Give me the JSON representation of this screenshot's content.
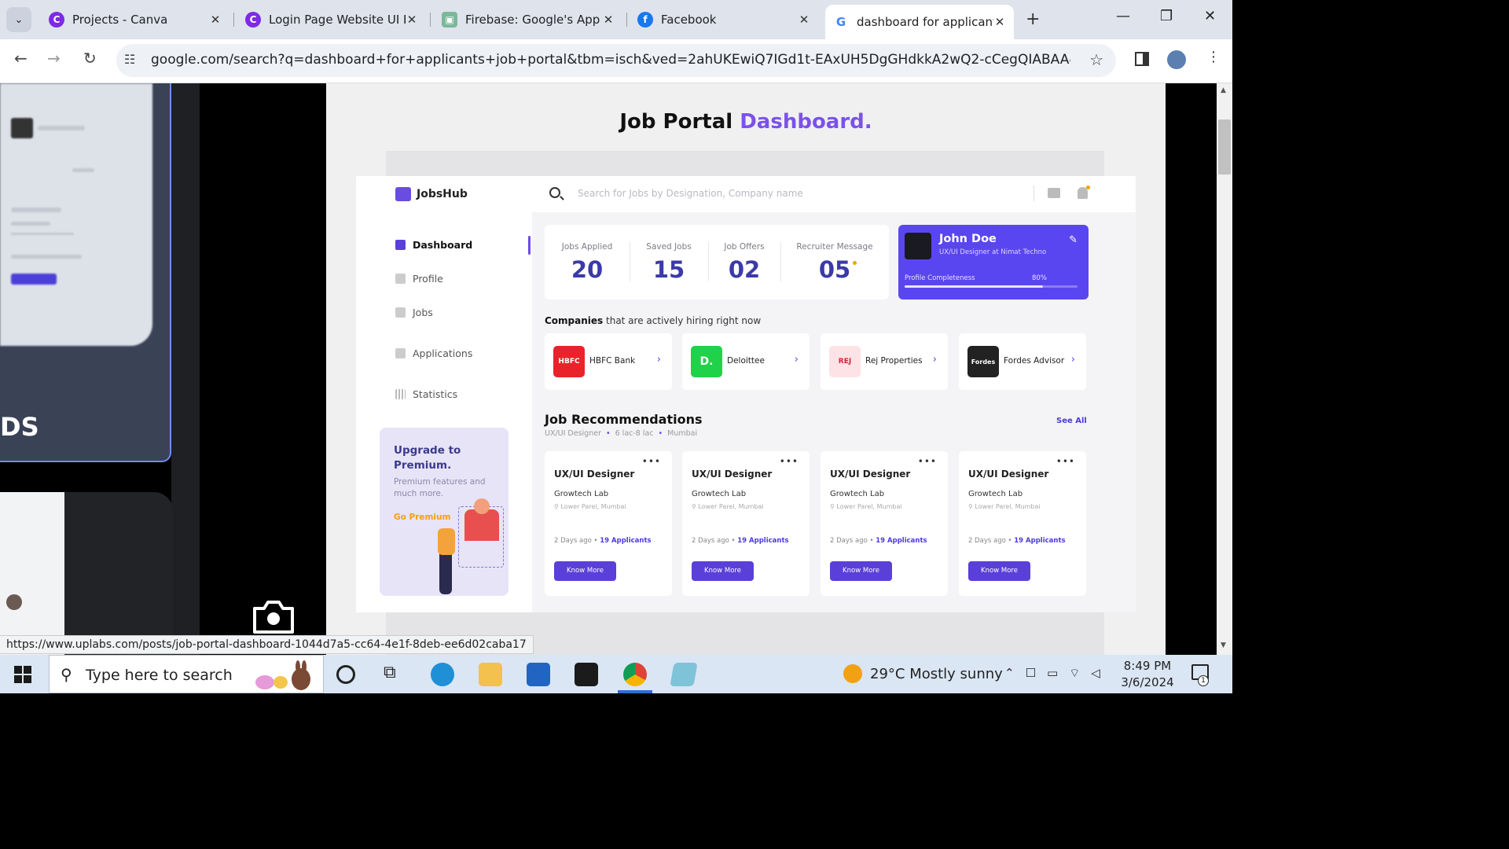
{
  "browser": {
    "tabs": [
      {
        "title": "Projects - Canva",
        "favicon": "canva-icon",
        "color": "#7d2ae8"
      },
      {
        "title": "Login Page Website UI Pr",
        "favicon": "canva-icon",
        "color": "#7d2ae8"
      },
      {
        "title": "Firebase: Google's App D",
        "favicon": "firebase-icon",
        "color": "#7cb89a"
      },
      {
        "title": "Facebook",
        "favicon": "facebook-icon",
        "color": "#1877f2"
      },
      {
        "title": "dashboard for applicants",
        "favicon": "google-icon",
        "color": "#4285f4"
      }
    ],
    "active_tab": 4,
    "url": "google.com/search?q=dashboard+for+applicants+job+portal&tbm=isch&ved=2ahUKEwiQ7IGd1t-EAxUH5DgGHdkkA2wQ2-cCegQIABAA&oq=dashboar...",
    "status_url": "https://www.uplabs.com/posts/job-portal-dashboard-1044d7a5-cc64-4e1f-8deb-ee6d02caba17"
  },
  "left_thumb": {
    "big_text": "DS"
  },
  "job_portal": {
    "title_black": "Job Portal",
    "title_accent": "Dashboard.",
    "accent_color": "#7b52e8",
    "logo": "JobsHub",
    "search_placeholder": "Search for Jobs by Designation, Company name",
    "menu": [
      {
        "label": "Dashboard",
        "active": true
      },
      {
        "label": "Profile"
      },
      {
        "label": "Jobs"
      },
      {
        "label": "Applications"
      },
      {
        "label": "Statistics"
      }
    ],
    "upgrade": {
      "title": "Upgrade to Premium.",
      "subtitle": "Premium features and much more.",
      "cta": "Go Premium"
    },
    "stats": [
      {
        "label": "Jobs Applied",
        "value": "20"
      },
      {
        "label": "Saved Jobs",
        "value": "15"
      },
      {
        "label": "Job Offers",
        "value": "02"
      },
      {
        "label": "Recruiter Message",
        "value": "05"
      }
    ],
    "profile": {
      "name": "John Doe",
      "role": "UX/UI Designer at Nimat Techno",
      "completeness_label": "Profile Completeness",
      "completeness_text": "80%",
      "completeness": 0.8
    },
    "companies_heading_bold": "Companies",
    "companies_heading_rest": " that are actively hiring right now",
    "companies": [
      {
        "logo": "HBFC",
        "name": "HBFC Bank",
        "bg": "#e8242a",
        "fg": "#ffffff"
      },
      {
        "logo": "D.",
        "name": "Deloittee",
        "bg": "#1fd24a",
        "fg": "#ffffff"
      },
      {
        "logo": "REJ",
        "name": "Rej Properties",
        "bg": "#fde2e6",
        "fg": "#d3223a"
      },
      {
        "logo": "Fordes",
        "name": "Fordes Advisor",
        "bg": "#222222",
        "fg": "#ffffff"
      }
    ],
    "recommendations": {
      "title": "Job Recommendations",
      "filters": [
        "UX/UI Designer",
        "6 lac-8 lac",
        "Mumbai"
      ],
      "see_all": "See All",
      "jobs": [
        {
          "title": "UX/UI Designer",
          "company": "Growtech Lab",
          "location": "Lower Parel, Mumbai",
          "posted": "2 Days ago",
          "applicants": "19 Applicants",
          "button": "Know More"
        },
        {
          "title": "UX/UI Designer",
          "company": "Growtech Lab",
          "location": "Lower Parel, Mumbai",
          "posted": "2 Days ago",
          "applicants": "19 Applicants",
          "button": "Know More"
        },
        {
          "title": "UX/UI Designer",
          "company": "Growtech Lab",
          "location": "Lower Parel, Mumbai",
          "posted": "2 Days ago",
          "applicants": "19 Applicants",
          "button": "Know More"
        },
        {
          "title": "UX/UI Designer",
          "company": "Growtech Lab",
          "location": "Lower Parel, Mumbai",
          "posted": "2 Days ago",
          "applicants": "19 Applicants",
          "button": "Know More"
        }
      ]
    }
  },
  "taskbar": {
    "search_text": "Type here to search",
    "weather": "29°C  Mostly sunny",
    "time": "8:49 PM",
    "date": "3/6/2024",
    "notification_count": "1"
  }
}
